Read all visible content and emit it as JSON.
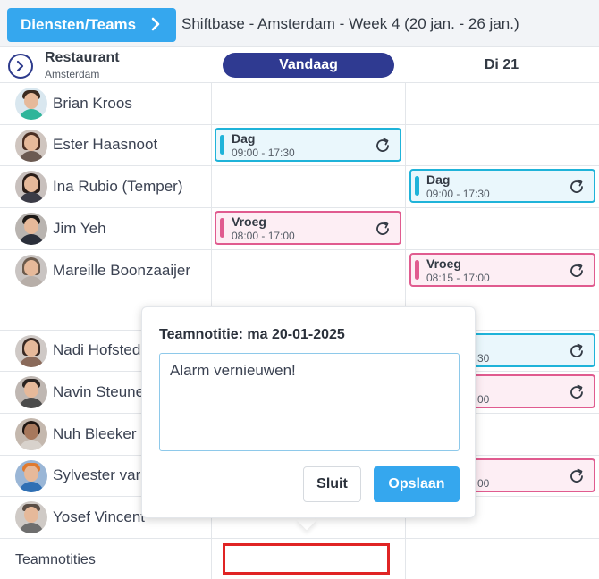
{
  "topbar": {
    "teams_button": "Diensten/Teams",
    "title": "Shiftbase - Amsterdam - Week 4 (20 jan. - 26 jan.)"
  },
  "header": {
    "location_name": "Restaurant",
    "location_sub": "Amsterdam",
    "today_label": "Vandaag",
    "day2_label": "Di 21"
  },
  "employees": [
    {
      "name": "Brian Kroos"
    },
    {
      "name": "Ester Haasnoot",
      "shift_today": {
        "name": "Dag",
        "time": "09:00 - 17:30"
      }
    },
    {
      "name": "Ina Rubio (Temper)",
      "shift_day2": {
        "name": "Dag",
        "time": "09:00 - 17:30"
      }
    },
    {
      "name": "Jim Yeh",
      "shift_today": {
        "name": "Vroeg",
        "time": "08:00 - 17:00"
      }
    },
    {
      "name": "Mareille Boonzaaijer",
      "shift_day2": {
        "name": "Vroeg",
        "time": "08:15 - 17:00"
      }
    },
    {
      "name": "Nadi Hofsted",
      "shift_day2_partial_time": "30"
    },
    {
      "name": "Navin Steune",
      "shift_day2_partial_time": "00"
    },
    {
      "name": "Nuh Bleeker"
    },
    {
      "name": "Sylvester var",
      "shift_day2_partial_time": "00"
    },
    {
      "name": "Yosef Vincent"
    }
  ],
  "teamnotes_label": "Teamnotities",
  "popup": {
    "title": "Teamnotitie: ma 20-01-2025",
    "text": "Alarm vernieuwen!",
    "cancel": "Sluit",
    "save": "Opslaan"
  },
  "colors": {
    "accent": "#35a7ee",
    "today_pill": "#2f3a91",
    "dag": "#1fb3d9",
    "vroeg": "#e05b8f",
    "highlight": "#e02424"
  }
}
